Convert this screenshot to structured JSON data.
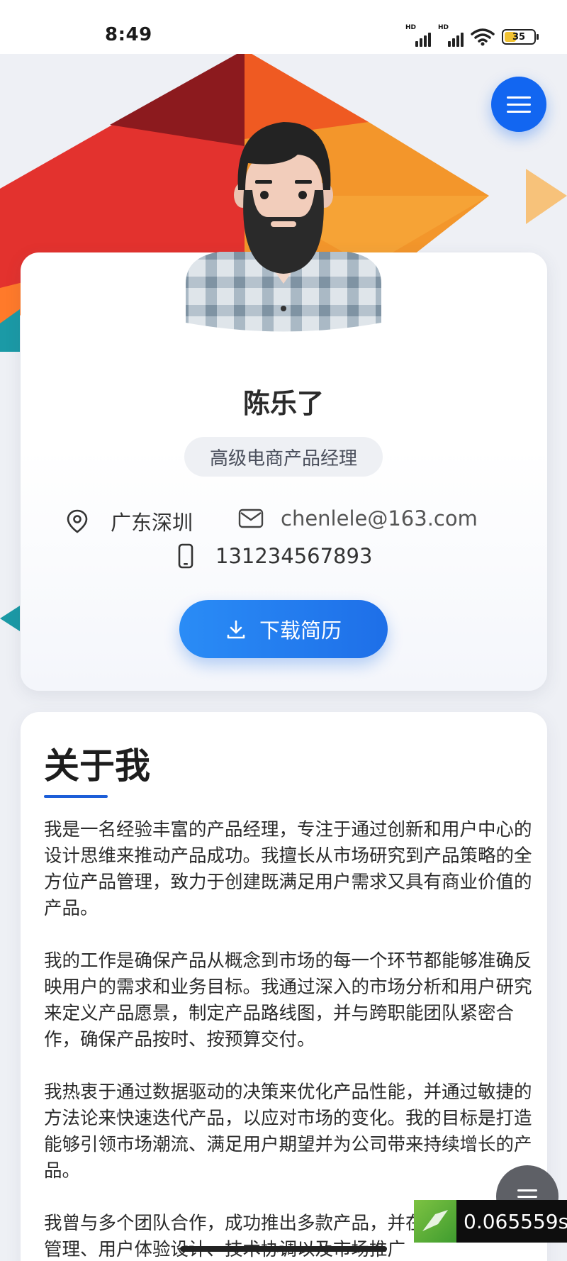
{
  "status_bar": {
    "time": "8:49",
    "battery": "35",
    "signal_labels": [
      "HD",
      "HD"
    ]
  },
  "profile": {
    "name": "陈乐了",
    "role": "高级电商产品经理",
    "location": "广东深圳",
    "email": "chenlele@163.com",
    "phone": "131234567893",
    "download_label": "下载简历"
  },
  "about": {
    "title": "关于我",
    "paragraphs": [
      "我是一名经验丰富的产品经理，专注于通过创新和用户中心的设计思维来推动产品成功。我擅长从市场研究到产品策略的全方位产品管理，致力于创建既满足用户需求又具有商业价值的产品。",
      "我的工作是确保产品从概念到市场的每一个环节都能够准确反映用户的需求和业务目标。我通过深入的市场分析和用户研究来定义产品愿景，制定产品路线图，并与跨职能团队紧密合作，确保产品按时、按预算交付。",
      "我热衷于通过数据驱动的决策来优化产品性能，并通过敏捷的方法论来快速迭代产品，以应对市场的变化。我的目标是打造能够引领市场潮流、满足用户期望并为公司带来持续增长的产品。",
      "我曾与多个团队合作，成功推出多款产品，并在产品全生周期管理、用户体验设计、技术协调以及市场推广"
    ]
  },
  "overlay": {
    "timer": "0.065559s"
  },
  "icons": {
    "menu": "menu-icon",
    "location": "location-pin-icon",
    "email": "mail-icon",
    "phone": "phone-icon",
    "download": "download-icon",
    "floating_menu": "list-icon"
  },
  "colors": {
    "accent": "#1266f1",
    "underline": "#1c5ed8",
    "badge_bg": "#eef0f4"
  }
}
